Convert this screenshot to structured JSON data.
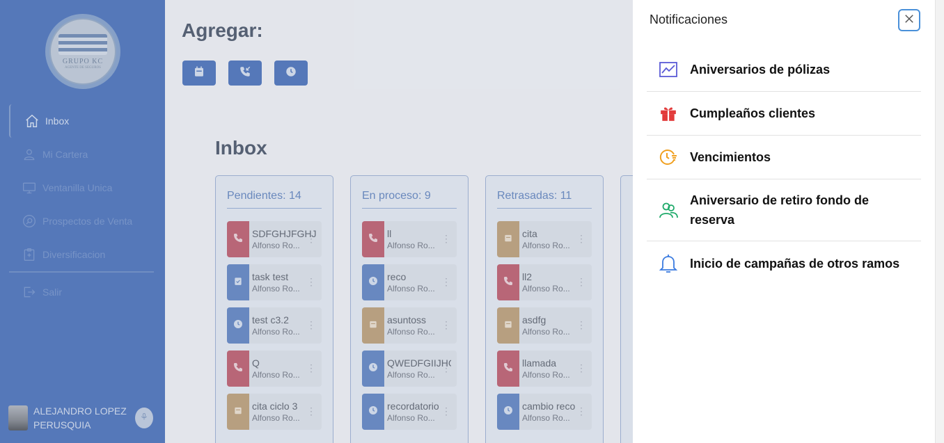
{
  "sidebar": {
    "logo": {
      "text": "GRUPO KC",
      "subtitle": "AGENTE DE SEGUROS"
    },
    "items": [
      {
        "label": "Inbox",
        "icon": "home-icon",
        "active": true
      },
      {
        "label": "Mi Cartera",
        "icon": "user-icon",
        "active": false
      },
      {
        "label": "Ventanilla Unica",
        "icon": "monitor-icon",
        "active": false
      },
      {
        "label": "Prospectos de Venta",
        "icon": "search-circle-icon",
        "active": false
      },
      {
        "label": "Diversificacion",
        "icon": "clipboard-icon",
        "active": false
      }
    ],
    "logout": {
      "label": "Salir",
      "icon": "logout-icon"
    },
    "user": {
      "name": "ALEJANDRO LOPEZ PERUSQUIA"
    }
  },
  "main": {
    "add_title": "Agregar:",
    "add_buttons": [
      "calendar-icon",
      "phone-incoming-icon",
      "clock-icon"
    ],
    "inbox_title": "Inbox",
    "columns": [
      {
        "header": "Pendientes: 14",
        "cards": [
          {
            "title": "SDFGHJFGHJ",
            "owner": "Alfonso Ro...",
            "type": "call",
            "color": "#c56a78"
          },
          {
            "title": "task test",
            "owner": "Alfonso Ro...",
            "type": "task",
            "color": "#6e8fc7"
          },
          {
            "title": "test c3.2",
            "owner": "Alfonso Ro...",
            "type": "reminder",
            "color": "#6e8fc7"
          },
          {
            "title": "Q",
            "owner": "Alfonso Ro...",
            "type": "call",
            "color": "#c56a78"
          },
          {
            "title": "cita ciclo 3",
            "owner": "Alfonso Ro...",
            "type": "meeting",
            "color": "#c4a882"
          }
        ]
      },
      {
        "header": "En proceso: 9",
        "cards": [
          {
            "title": "ll",
            "owner": "Alfonso Ro...",
            "type": "call",
            "color": "#c56a78"
          },
          {
            "title": "reco",
            "owner": "Alfonso Ro...",
            "type": "reminder",
            "color": "#6e8fc7"
          },
          {
            "title": "asuntoss",
            "owner": "Alfonso Ro...",
            "type": "meeting",
            "color": "#c4a882"
          },
          {
            "title": "QWEDFGIIJHG",
            "owner": "Alfonso Ro...",
            "type": "reminder",
            "color": "#6e8fc7"
          },
          {
            "title": "recordatorio",
            "owner": "Alfonso Ro...",
            "type": "reminder",
            "color": "#6e8fc7"
          }
        ]
      },
      {
        "header": "Retrasadas: 11",
        "cards": [
          {
            "title": "cita",
            "owner": "Alfonso Ro...",
            "type": "meeting",
            "color": "#c4a882"
          },
          {
            "title": "ll2",
            "owner": "Alfonso Ro...",
            "type": "call",
            "color": "#c56a78"
          },
          {
            "title": "asdfg",
            "owner": "Alfonso Ro...",
            "type": "meeting",
            "color": "#c4a882"
          },
          {
            "title": "llamada",
            "owner": "Alfonso Ro...",
            "type": "call",
            "color": "#c56a78"
          },
          {
            "title": "cambio reco",
            "owner": "Alfonso Ro...",
            "type": "reminder",
            "color": "#6e8fc7"
          }
        ]
      }
    ]
  },
  "notifications": {
    "title": "Notificaciones",
    "items": [
      {
        "label": "Aniversarios de pólizas",
        "icon": "chart-line-icon",
        "color": "#5b5bd6"
      },
      {
        "label": "Cumpleaños clientes",
        "icon": "gift-icon",
        "color": "#e23b3b"
      },
      {
        "label": "Vencimientos",
        "icon": "clock-alert-icon",
        "color": "#f0a020"
      },
      {
        "label": "Aniversario de retiro fondo de reserva",
        "icon": "users-icon",
        "color": "#1faa6a"
      },
      {
        "label": "Inicio de campañas de otros ramos",
        "icon": "bell-icon",
        "color": "#3a7be0"
      }
    ]
  }
}
